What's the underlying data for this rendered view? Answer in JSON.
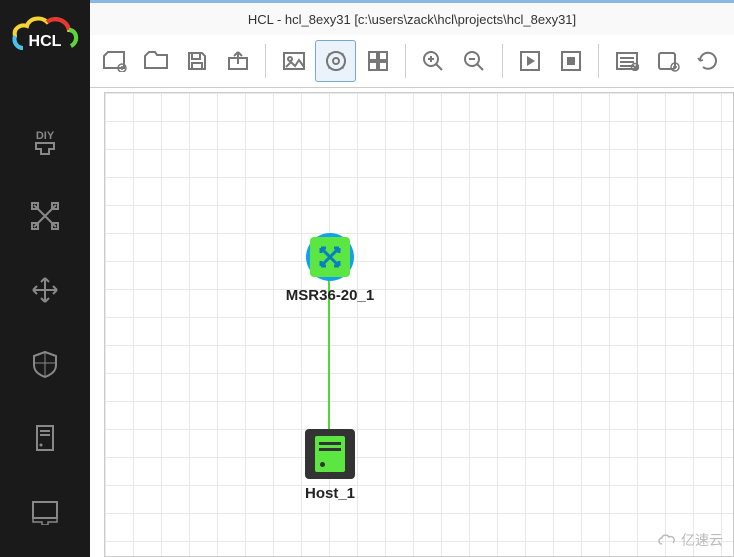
{
  "title": "HCL - hcl_8exy31 [c:\\users\\zack\\hcl\\projects\\hcl_8exy31]",
  "logo_text": "HCL",
  "sidebar": {
    "items": [
      {
        "name": "diy"
      },
      {
        "name": "connect"
      },
      {
        "name": "move"
      },
      {
        "name": "shield"
      },
      {
        "name": "server"
      },
      {
        "name": "screen"
      }
    ]
  },
  "toolbar": {
    "groups": [
      [
        "new",
        "open",
        "save",
        "export"
      ],
      [
        "image",
        "settings",
        "grid"
      ],
      [
        "zoom-in",
        "zoom-out"
      ],
      [
        "play",
        "stop"
      ],
      [
        "list",
        "add-note",
        "refresh"
      ]
    ]
  },
  "nodes": {
    "router": {
      "label": "MSR36-20_1"
    },
    "host": {
      "label": "Host_1"
    }
  },
  "watermark": "亿速云"
}
